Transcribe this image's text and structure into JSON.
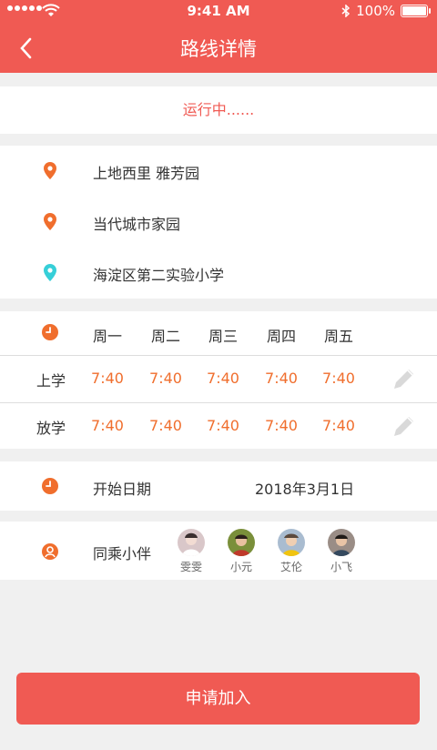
{
  "status_bar": {
    "time": "9:41 AM",
    "battery": "100%"
  },
  "header": {
    "title": "路线详情"
  },
  "run_status": "运行中......",
  "addresses": [
    "上地西里 雅芳园",
    "当代城市家园",
    "海淀区第二实验小学"
  ],
  "schedule": {
    "days": [
      "周一",
      "周二",
      "周三",
      "周四",
      "周五"
    ],
    "rows": [
      {
        "label": "上学",
        "times": [
          "7:40",
          "7:40",
          "7:40",
          "7:40",
          "7:40"
        ]
      },
      {
        "label": "放学",
        "times": [
          "7:40",
          "7:40",
          "7:40",
          "7:40",
          "7:40"
        ]
      }
    ]
  },
  "start": {
    "label": "开始日期",
    "value": "2018年3月1日"
  },
  "companions": {
    "label": "同乘小伴",
    "members": [
      {
        "name": "雯雯",
        "color": "#d9c7c9"
      },
      {
        "name": "小元",
        "color": "#7a8f3a"
      },
      {
        "name": "艾伦",
        "color": "#a9bcd0"
      },
      {
        "name": "小飞",
        "color": "#9a8d86"
      }
    ]
  },
  "join_button": "申请加入",
  "colors": {
    "accent": "#f05a53",
    "orange_pin": "#f06e2d",
    "cyan_pin": "#36cfd8",
    "time": "#f06e2d"
  }
}
